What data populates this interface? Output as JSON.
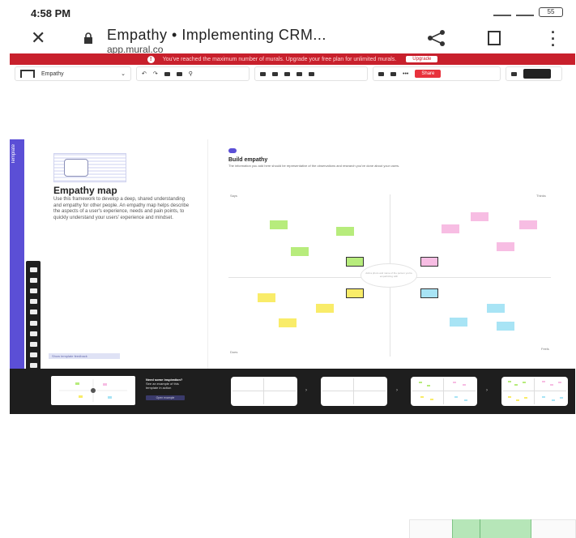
{
  "status": {
    "time": "4:58 PM",
    "battery": "55"
  },
  "browser": {
    "title": "Empathy • Implementing CRM...",
    "url": "app.mural.co"
  },
  "banner": {
    "message": "You've reached the maximum number of murals. Upgrade your free plan for unlimited murals.",
    "button": "Upgrade"
  },
  "toolbar": {
    "mural_name": "Empathy",
    "share": "Share",
    "more": "•••"
  },
  "template": {
    "strip_label": "Template",
    "title": "Empathy map",
    "description": "Use this framework to develop a deep, shared understanding and empathy for other people. An empathy map helps describe the aspects of a user's experience, needs and pain points, to quickly understand your users' experience and mindset.",
    "footer": "Show template feedback"
  },
  "board": {
    "title": "Build empathy",
    "subtitle": "The information you add here should be representative of the observations and research you've done about your users.",
    "quadrants": {
      "says": "Says",
      "thinks": "Thinks",
      "does": "Does",
      "feels": "Feels"
    },
    "center_text": "Add a photo and name of the person you're empathizing with"
  },
  "bottom": {
    "thumb_title": "Need some inspiration?",
    "thumb_body": "See an example of this template in action",
    "thumb_button": "Open example"
  },
  "colors": {
    "banner": "#c8202c",
    "accent": "#5b4fd6",
    "note_green": "#b7ec7c",
    "note_pink": "#f7bde3",
    "note_yellow": "#f9ec69",
    "note_cyan": "#a8e4f5"
  }
}
